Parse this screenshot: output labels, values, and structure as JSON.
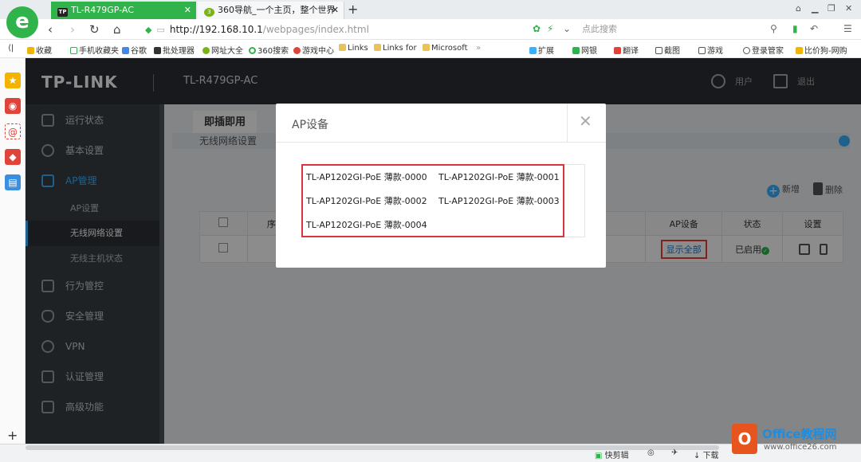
{
  "browser": {
    "tabs": [
      {
        "label": "TL-R479GP-AC",
        "icon": "TP"
      },
      {
        "label": "360导航_一个主页，整个世界",
        "icon": "3"
      }
    ],
    "new_tab": "+",
    "url_host": "http://192.168.10.1",
    "url_path": "/webpages/index.html",
    "search_placeholder": "点此搜索",
    "bookmarks": [
      "收藏",
      "手机收藏夹",
      "谷歌",
      "批处理器",
      "网址大全",
      "360搜索",
      "游戏中心",
      "Links",
      "Links for",
      "Microsoft"
    ],
    "right_tools": [
      "扩展",
      "网银",
      "翻译",
      "截图",
      "游戏",
      "登录管家",
      "比价狗-网购"
    ]
  },
  "app": {
    "brand": "TP-LINK",
    "model": "TL-R479GP-AC",
    "user_label": "用户",
    "logout_label": "退出",
    "menu": [
      {
        "label": "运行状态",
        "icon": "monitor-icon"
      },
      {
        "label": "基本设置",
        "icon": "gear-icon"
      },
      {
        "label": "AP管理",
        "icon": "antenna-icon"
      },
      {
        "label": "行为管控",
        "icon": "control-icon"
      },
      {
        "label": "安全管理",
        "icon": "shield-icon"
      },
      {
        "label": "VPN",
        "icon": "cloud-icon"
      },
      {
        "label": "认证管理",
        "icon": "auth-icon"
      },
      {
        "label": "高级功能",
        "icon": "grid-icon"
      }
    ],
    "submenu": [
      "AP设置",
      "无线网络设置",
      "无线主机状态"
    ],
    "content": {
      "tab": "即插即用",
      "breadcrumb": "无线网络设置",
      "add_label": "新增",
      "delete_label": "删除",
      "columns": [
        "序",
        "AP设备",
        "状态",
        "设置"
      ],
      "row": {
        "ap_device": "显示全部",
        "status": "已启用"
      }
    }
  },
  "modal": {
    "title": "AP设备",
    "items": [
      "TL-AP1202GI-PoE 薄款-0000",
      "TL-AP1202GI-PoE 薄款-0001",
      "TL-AP1202GI-PoE 薄款-0002",
      "TL-AP1202GI-PoE 薄款-0003",
      "TL-AP1202GI-PoE 薄款-0004"
    ]
  },
  "statusbar": {
    "items": [
      "快剪辑",
      "下载"
    ]
  },
  "watermark": {
    "title": "Office教程网",
    "url": "www.office26.com"
  },
  "colors": {
    "accent": "#2fb34a",
    "tplink_blue": "#3bb0ff",
    "highlight_red": "#d9363e"
  }
}
